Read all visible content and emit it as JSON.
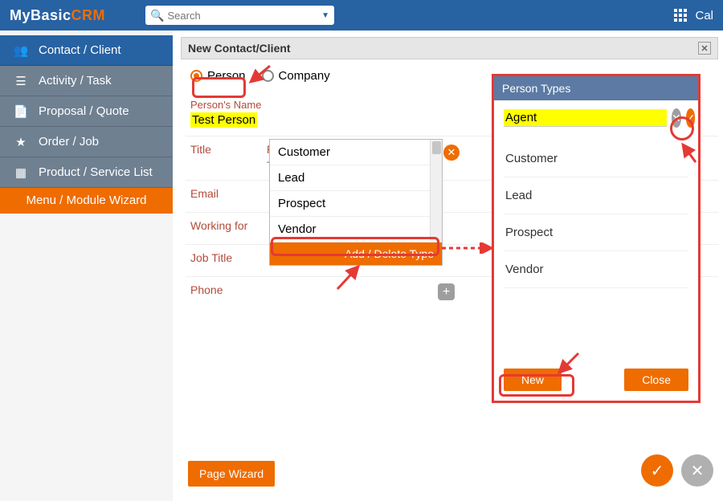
{
  "brand": {
    "prefix": "MyBasic",
    "suffix": "CRM"
  },
  "search": {
    "placeholder": "Search"
  },
  "topbar": {
    "calendar": "Cal"
  },
  "sidebar": {
    "items": [
      {
        "label": "Contact / Client"
      },
      {
        "label": "Activity / Task"
      },
      {
        "label": "Proposal / Quote"
      },
      {
        "label": "Order / Job"
      },
      {
        "label": "Product / Service List"
      }
    ],
    "wizard": "Menu / Module Wizard"
  },
  "panel": {
    "title": "New Contact/Client",
    "radio": {
      "person": "Person",
      "company": "Company"
    },
    "name_label": "Person's Name",
    "name_value": "Test Person",
    "fields": {
      "title": "Title",
      "email": "Email",
      "working_for": "Working for",
      "job_title": "Job Title",
      "phone": "Phone",
      "person_type": "Person Type"
    },
    "ptype_placeholder": "Type to search"
  },
  "dropdown": {
    "items": [
      "Customer",
      "Lead",
      "Prospect",
      "Vendor"
    ],
    "footer": "Add / Delete Type"
  },
  "types_modal": {
    "title": "Person Types",
    "input_value": "Agent",
    "items": [
      "Customer",
      "Lead",
      "Prospect",
      "Vendor"
    ],
    "new_btn": "New",
    "close_btn": "Close"
  },
  "bottom": {
    "page_wizard": "Page Wizard"
  }
}
